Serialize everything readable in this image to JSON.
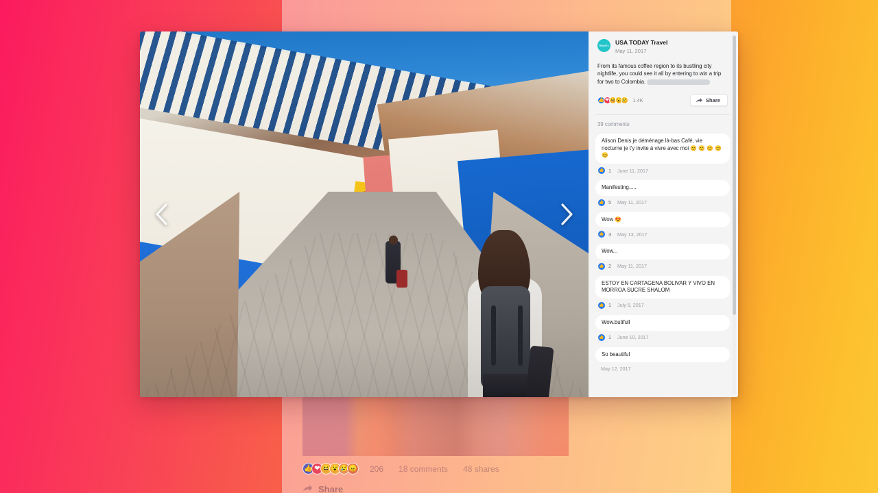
{
  "theme": {
    "gradient_start": "#fb1a5e",
    "gradient_end": "#fdc733",
    "accent_blue": "#2078f4",
    "avatar_color": "#21c4c9"
  },
  "modal": {
    "photo": {
      "alt": "Woman with backpack walking down a colorful cobblestone street in Bogota, Colombia",
      "prev_label": "Previous photo",
      "next_label": "Next photo"
    },
    "post": {
      "page_name": "USA TODAY Travel",
      "avatar_text": "TRAVEL",
      "date": "May 11, 2017",
      "body": "From its famous coffee region to its bustling city nightlife, you could see it all by entering to win a trip for two to Colombia.",
      "redacted": true,
      "reactions": [
        "like",
        "love",
        "haha",
        "wow",
        "sad"
      ],
      "reaction_count": "1.4K",
      "share_label": "Share",
      "comments_count_label": "39 comments"
    },
    "comments": [
      {
        "text": "Alison Denis je déménage là-bas Café, vie nocturne je t'y invite à vivre avec moi 😊 😊 😊 😊 😊",
        "likes": "1",
        "date": "June 11, 2017"
      },
      {
        "text": "Manifesting.....",
        "likes": "5",
        "date": "May 11, 2017"
      },
      {
        "text": "Wow 😍",
        "likes": "3",
        "date": "May 13, 2017"
      },
      {
        "text": "Wow...",
        "likes": "2",
        "date": "May 11, 2017"
      },
      {
        "text": "ESTOY EN CARTAGENA BOLIVAR Y VIVO EN MORROA SUCRE SHALOM",
        "likes": "1",
        "date": "July 5, 2017"
      },
      {
        "text": "Wow.butifull",
        "likes": "1",
        "date": "June 10, 2017"
      },
      {
        "text": "So beautiful",
        "likes": "",
        "date": "May 12, 2017"
      }
    ]
  },
  "background_post": {
    "reactions": [
      "like",
      "love",
      "haha",
      "wow",
      "sad",
      "angry"
    ],
    "reaction_count": "206",
    "comments_label": "18 comments",
    "shares_label": "48 shares",
    "share_label": "Share"
  }
}
